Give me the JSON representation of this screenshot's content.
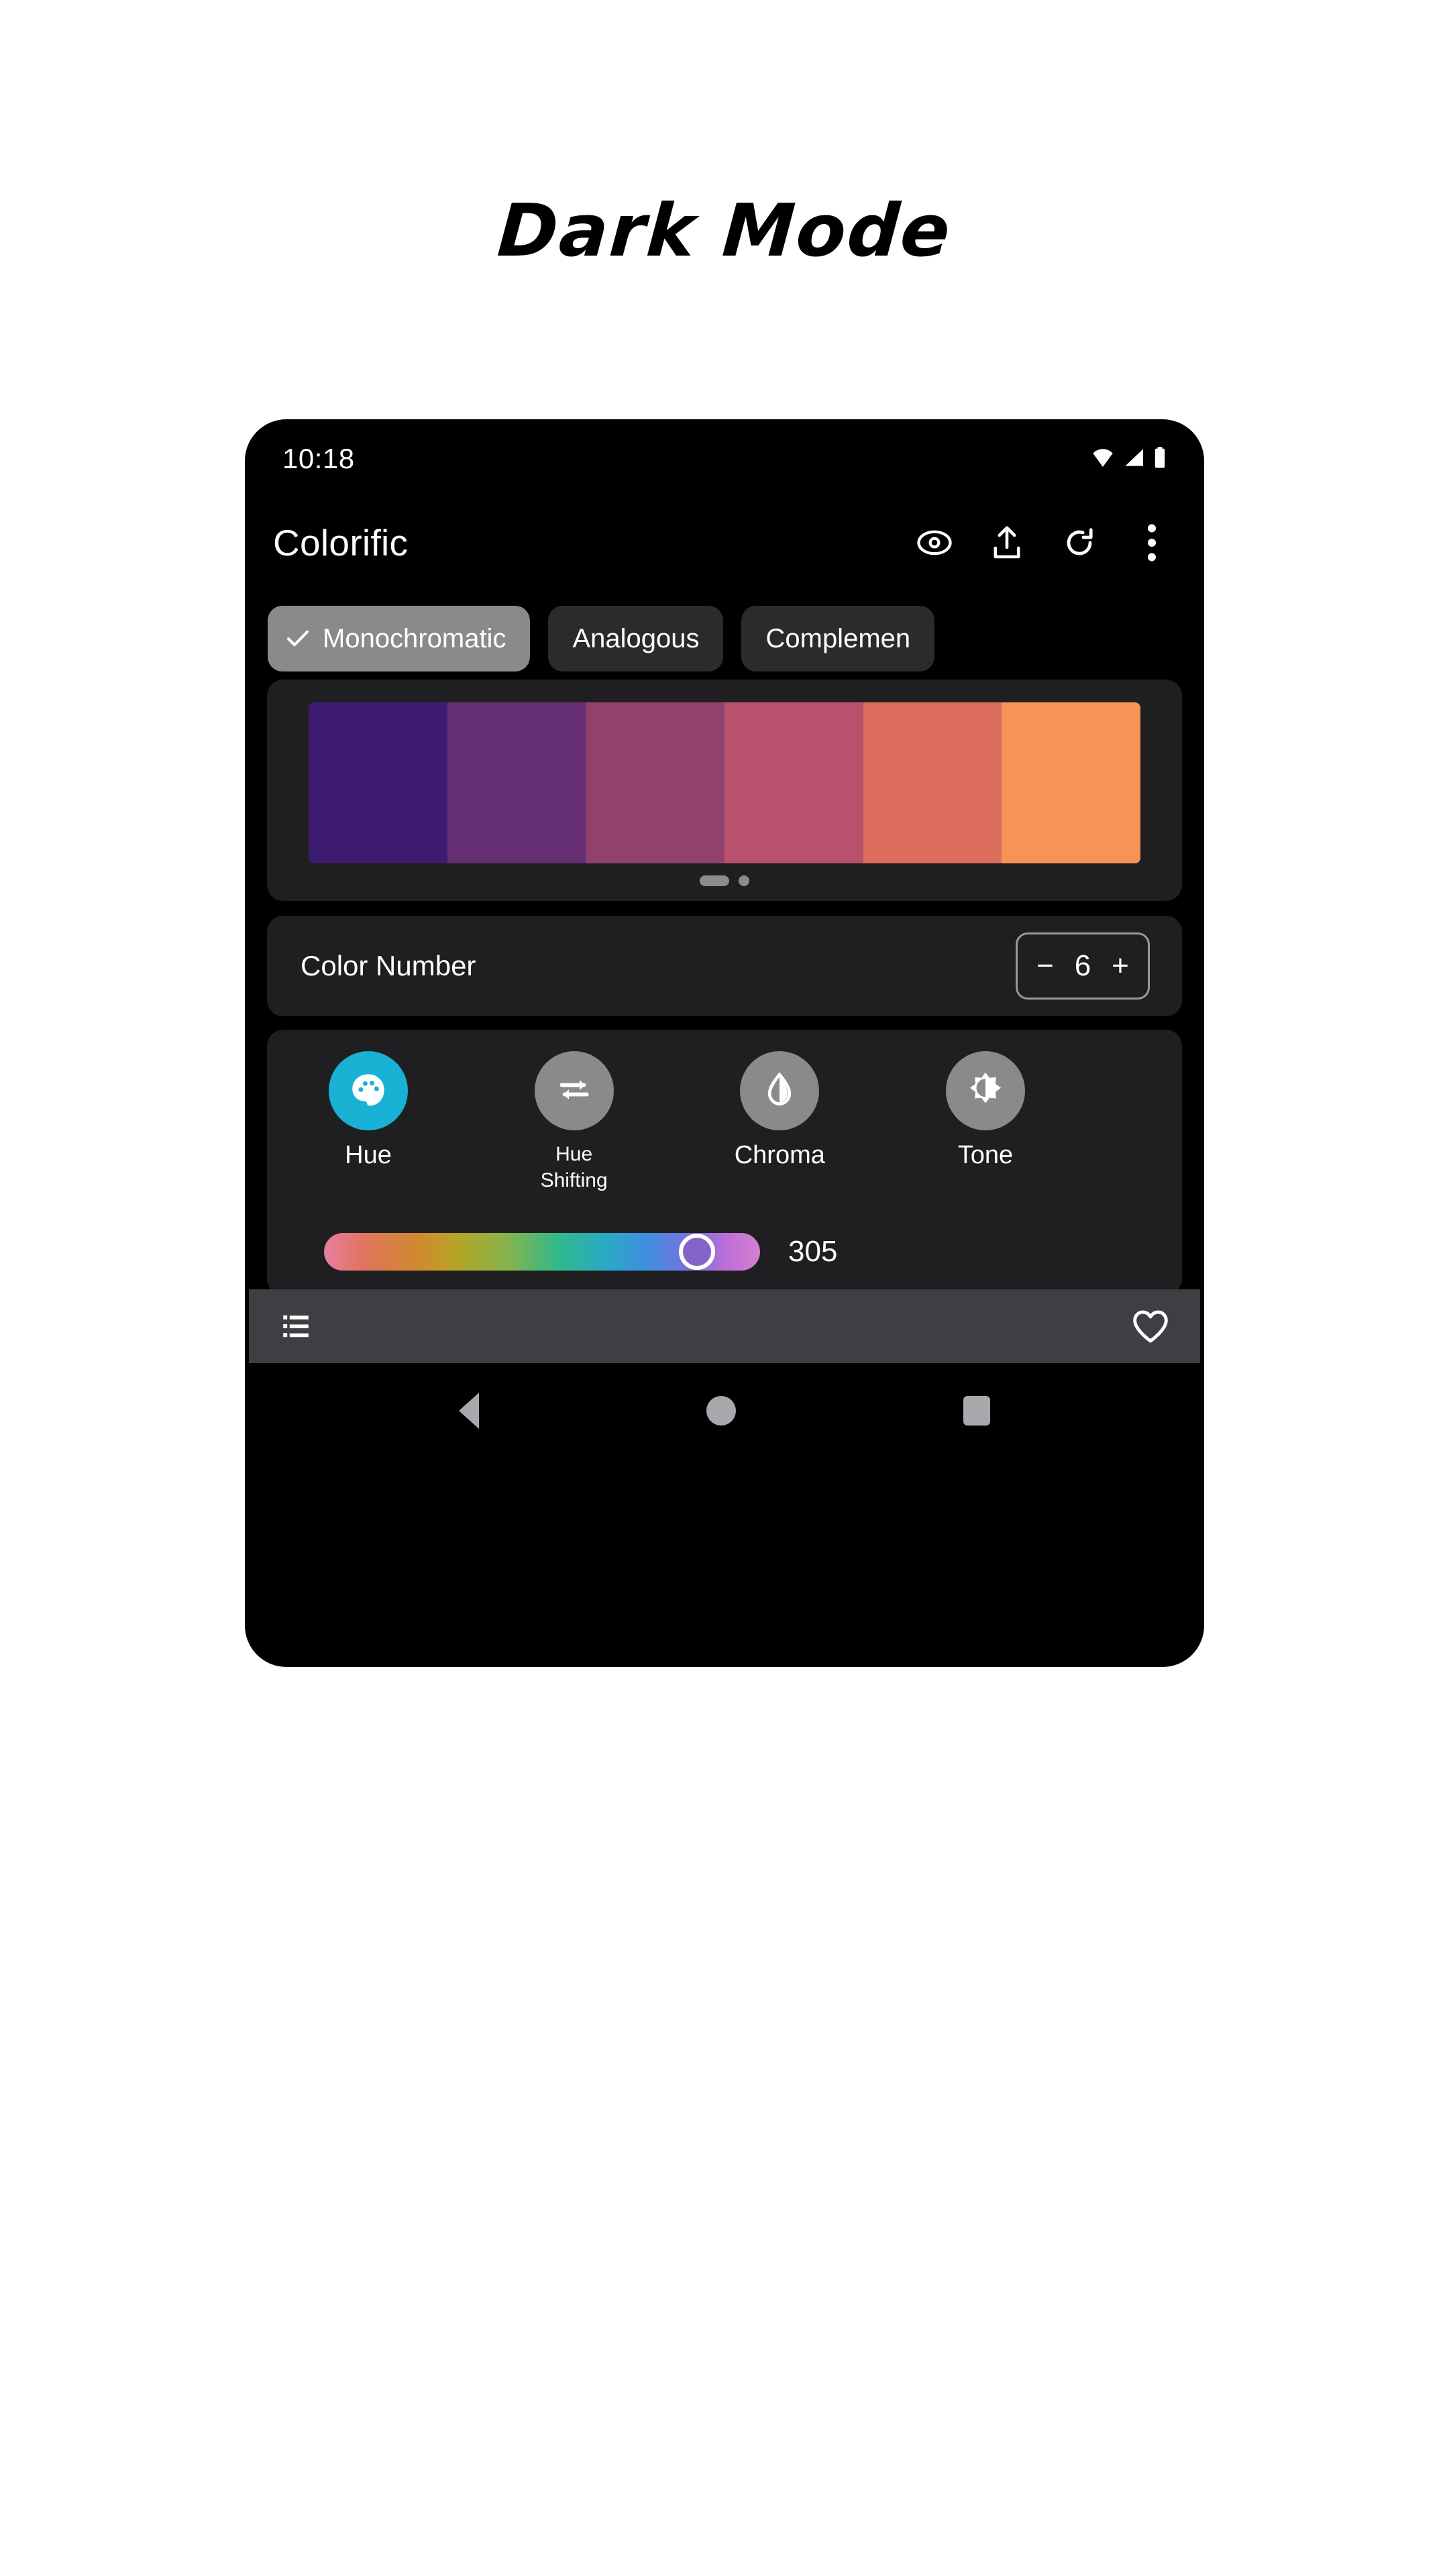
{
  "page": {
    "title": "Dark Mode",
    "background": "#ffffff"
  },
  "phone": {
    "frame_color": "#000000",
    "status_bar": {
      "time": "10:18",
      "icons": [
        "wifi-icon",
        "cellular-signal-icon",
        "battery-icon"
      ]
    },
    "app_bar": {
      "title": "Colorific",
      "actions": [
        {
          "name": "preview-eye-icon",
          "label": "Preview"
        },
        {
          "name": "share-icon",
          "label": "Share"
        },
        {
          "name": "refresh-icon",
          "label": "Refresh"
        },
        {
          "name": "overflow-menu-icon",
          "label": "More options"
        }
      ]
    },
    "chips": [
      {
        "label": "Monochromatic",
        "selected": true
      },
      {
        "label": "Analogous",
        "selected": false
      },
      {
        "label": "Complemen",
        "selected": false,
        "clipped": true
      }
    ],
    "palette_card": {
      "swatches": [
        "#3C1B70",
        "#652D73",
        "#92416F",
        "#B8516D",
        "#DC6C5C",
        "#F69455"
      ],
      "pager": {
        "active_index": 0,
        "count": 2
      }
    },
    "color_number": {
      "label": "Color Number",
      "decrement": "−",
      "value": "6",
      "increment": "+"
    },
    "tools": [
      {
        "label": "Hue",
        "icon": "palette-icon",
        "active": true,
        "color": "#17b2d4"
      },
      {
        "label": "Hue\nShifting",
        "label_line1": "Hue",
        "label_line2": "Shifting",
        "icon": "swap-arrows-icon",
        "active": false,
        "color": "#8a8a8a"
      },
      {
        "label": "Chroma",
        "icon": "water-drop-icon",
        "active": false,
        "color": "#8a8a8a"
      },
      {
        "label": "Tone",
        "icon": "brightness-icon",
        "active": false,
        "color": "#8a8a8a"
      }
    ],
    "slider": {
      "name": "hue-slider",
      "value": "305",
      "min": 0,
      "max": 360,
      "thumb_color": "#8562c8"
    },
    "bottom_bar": {
      "background": "#403e42",
      "left_icon": "list-icon",
      "right_icon": "favorite-heart-icon"
    },
    "nav_bar": {
      "back": "back-triangle-icon",
      "home": "home-circle-icon",
      "recents": "recents-square-icon",
      "color": "#a8a8ad"
    }
  }
}
